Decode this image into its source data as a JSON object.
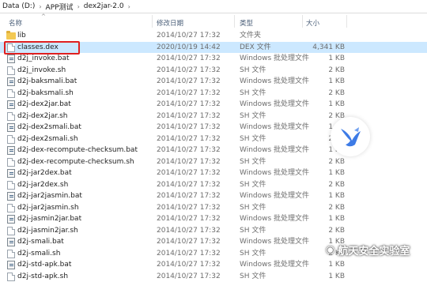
{
  "breadcrumb": [
    "Data (D:)",
    "APP测试",
    "dex2jar-2.0"
  ],
  "columns": {
    "name": "名称",
    "date": "修改日期",
    "type": "类型",
    "size": "大小"
  },
  "files": [
    {
      "icon": "folder-icon",
      "name": "lib",
      "date": "2014/10/27 17:32",
      "type": "文件夹",
      "size": ""
    },
    {
      "icon": "file-icon",
      "name": "classes.dex",
      "date": "2020/10/19 14:42",
      "type": "DEX 文件",
      "size": "4,341 KB",
      "selected": true
    },
    {
      "icon": "batch-file-icon",
      "name": "d2j_invoke.bat",
      "date": "2014/10/27 17:32",
      "type": "Windows 批处理文件",
      "size": "1 KB"
    },
    {
      "icon": "file-icon",
      "name": "d2j_invoke.sh",
      "date": "2014/10/27 17:32",
      "type": "SH 文件",
      "size": "2 KB"
    },
    {
      "icon": "batch-file-icon",
      "name": "d2j-baksmali.bat",
      "date": "2014/10/27 17:32",
      "type": "Windows 批处理文件",
      "size": "1 KB"
    },
    {
      "icon": "file-icon",
      "name": "d2j-baksmali.sh",
      "date": "2014/10/27 17:32",
      "type": "SH 文件",
      "size": "2 KB"
    },
    {
      "icon": "batch-file-icon",
      "name": "d2j-dex2jar.bat",
      "date": "2014/10/27 17:32",
      "type": "Windows 批处理文件",
      "size": "1 KB"
    },
    {
      "icon": "file-icon",
      "name": "d2j-dex2jar.sh",
      "date": "2014/10/27 17:32",
      "type": "SH 文件",
      "size": "2 KB"
    },
    {
      "icon": "batch-file-icon",
      "name": "d2j-dex2smali.bat",
      "date": "2014/10/27 17:32",
      "type": "Windows 批处理文件",
      "size": "1 KB"
    },
    {
      "icon": "file-icon",
      "name": "d2j-dex2smali.sh",
      "date": "2014/10/27 17:32",
      "type": "SH 文件",
      "size": "2 KB"
    },
    {
      "icon": "batch-file-icon",
      "name": "d2j-dex-recompute-checksum.bat",
      "date": "2014/10/27 17:32",
      "type": "Windows 批处理文件",
      "size": "1 KB"
    },
    {
      "icon": "file-icon",
      "name": "d2j-dex-recompute-checksum.sh",
      "date": "2014/10/27 17:32",
      "type": "SH 文件",
      "size": "2 KB"
    },
    {
      "icon": "batch-file-icon",
      "name": "d2j-jar2dex.bat",
      "date": "2014/10/27 17:32",
      "type": "Windows 批处理文件",
      "size": "1 KB"
    },
    {
      "icon": "file-icon",
      "name": "d2j-jar2dex.sh",
      "date": "2014/10/27 17:32",
      "type": "SH 文件",
      "size": "2 KB"
    },
    {
      "icon": "batch-file-icon",
      "name": "d2j-jar2jasmin.bat",
      "date": "2014/10/27 17:32",
      "type": "Windows 批处理文件",
      "size": "1 KB"
    },
    {
      "icon": "file-icon",
      "name": "d2j-jar2jasmin.sh",
      "date": "2014/10/27 17:32",
      "type": "SH 文件",
      "size": "2 KB"
    },
    {
      "icon": "batch-file-icon",
      "name": "d2j-jasmin2jar.bat",
      "date": "2014/10/27 17:32",
      "type": "Windows 批处理文件",
      "size": "1 KB"
    },
    {
      "icon": "file-icon",
      "name": "d2j-jasmin2jar.sh",
      "date": "2014/10/27 17:32",
      "type": "SH 文件",
      "size": "2 KB"
    },
    {
      "icon": "batch-file-icon",
      "name": "d2j-smali.bat",
      "date": "2014/10/27 17:32",
      "type": "Windows 批处理文件",
      "size": "1 KB"
    },
    {
      "icon": "file-icon",
      "name": "d2j-smali.sh",
      "date": "2014/10/27 17:32",
      "type": "SH 文件",
      "size": "2 KB"
    },
    {
      "icon": "batch-file-icon",
      "name": "d2j-std-apk.bat",
      "date": "2014/10/27 17:32",
      "type": "Windows 批处理文件",
      "size": "1 KB"
    },
    {
      "icon": "file-icon",
      "name": "d2j-std-apk.sh",
      "date": "2014/10/27 17:32",
      "type": "SH 文件",
      "size": "1 KB"
    }
  ],
  "watermark": "航天安全实验室",
  "colors": {
    "selection": "#cce8ff",
    "highlight_box": "#e02020",
    "folder": "#f3c953",
    "bird_icon": "#3d7be6"
  }
}
